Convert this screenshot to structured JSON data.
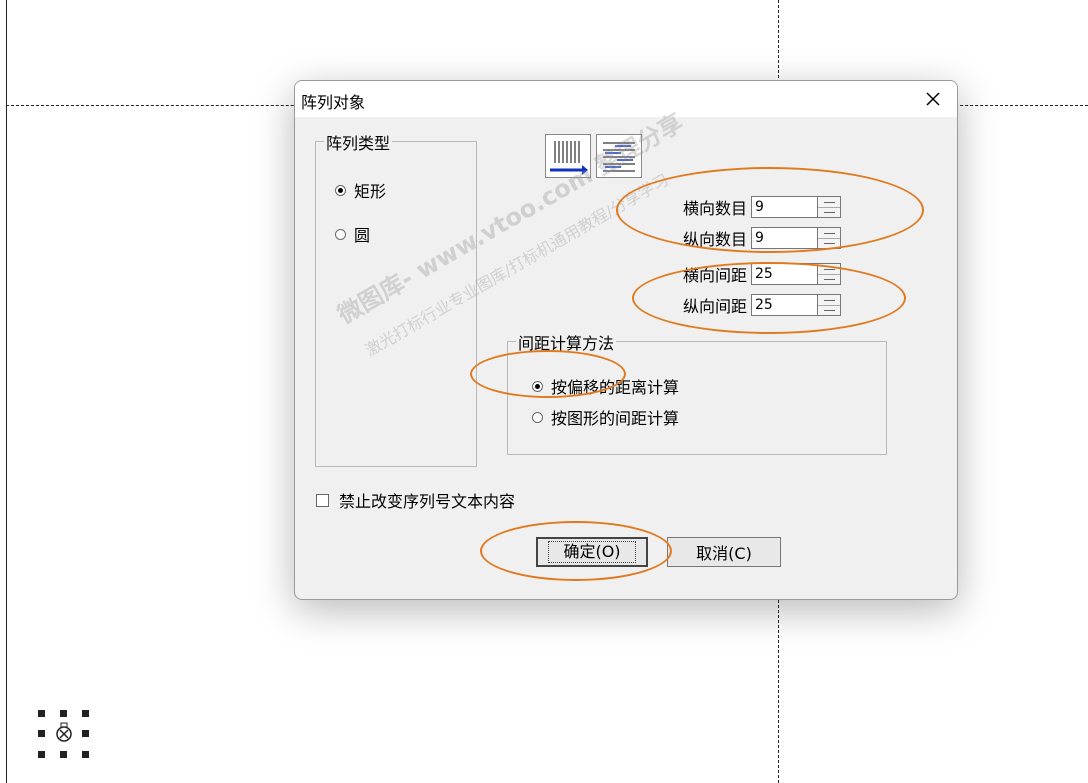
{
  "dialog": {
    "title": "阵列对象",
    "array_type": {
      "label": "阵列类型",
      "options": [
        {
          "label": "矩形",
          "selected": true
        },
        {
          "label": "圆",
          "selected": false
        }
      ]
    },
    "fields": [
      {
        "label": "横向数目",
        "value": "9"
      },
      {
        "label": "纵向数目",
        "value": "9"
      },
      {
        "label": "横向间距",
        "value": "25"
      },
      {
        "label": "纵向间距",
        "value": "25"
      }
    ],
    "spacing_method": {
      "label": "间距计算方法",
      "options": [
        {
          "label": "按偏移的距离计算",
          "selected": true
        },
        {
          "label": "按图形的间距计算",
          "selected": false
        }
      ]
    },
    "lock_checkbox": {
      "label": "禁止改变序列号文本内容",
      "checked": false
    },
    "ok_label": "确定(O)",
    "cancel_label": "取消(C)"
  },
  "watermark": {
    "line1": "微图库- www.vtoo.com 整理分享",
    "line2": "激光打标行业专业图库/打标机通用教程/分享学习"
  },
  "colors": {
    "annotation": "#e07a1f"
  }
}
